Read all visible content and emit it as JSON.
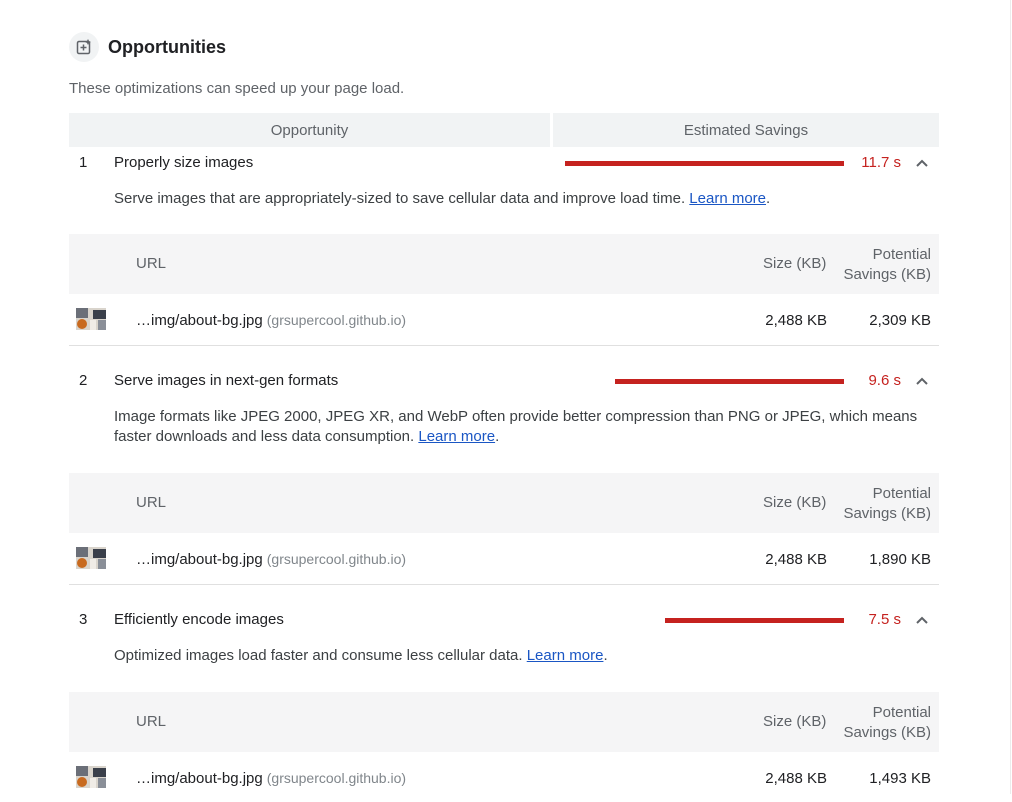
{
  "header": {
    "title": "Opportunities",
    "icon": "audit-icon",
    "subtitle": "These optimizations can speed up your page load."
  },
  "columns": {
    "opportunity": "Opportunity",
    "savings": "Estimated Savings"
  },
  "table_headers": {
    "url": "URL",
    "size": "Size (KB)",
    "potential_line1": "Potential",
    "potential_line2": "Savings (KB)"
  },
  "colors": {
    "savings_red": "#c5221f",
    "link_blue": "#1a56c4"
  },
  "opportunities": [
    {
      "num": "1",
      "title": "Properly size images",
      "savings": "11.7 s",
      "savings_fraction": 1.0,
      "desc": "Serve images that are appropriately-sized to save cellular data and improve load time. ",
      "learn_more": "Learn more",
      "tail": ".",
      "row": {
        "url": "…img/about-bg.jpg",
        "host": "(grsupercool.github.io)",
        "size": "2,488 KB",
        "potential": "2,309 KB"
      }
    },
    {
      "num": "2",
      "title": "Serve images in next-gen formats",
      "savings": "9.6 s",
      "savings_fraction": 0.82,
      "desc": "Image formats like JPEG 2000, JPEG XR, and WebP often provide better compression than PNG or JPEG, which means faster downloads and less data consumption. ",
      "learn_more": "Learn more",
      "tail": ".",
      "row": {
        "url": "…img/about-bg.jpg",
        "host": "(grsupercool.github.io)",
        "size": "2,488 KB",
        "potential": "1,890 KB"
      }
    },
    {
      "num": "3",
      "title": "Efficiently encode images",
      "savings": "7.5 s",
      "savings_fraction": 0.64,
      "desc": "Optimized images load faster and consume less cellular data. ",
      "learn_more": "Learn more",
      "tail": ".",
      "row": {
        "url": "…img/about-bg.jpg",
        "host": "(grsupercool.github.io)",
        "size": "2,488 KB",
        "potential": "1,493 KB"
      }
    }
  ]
}
